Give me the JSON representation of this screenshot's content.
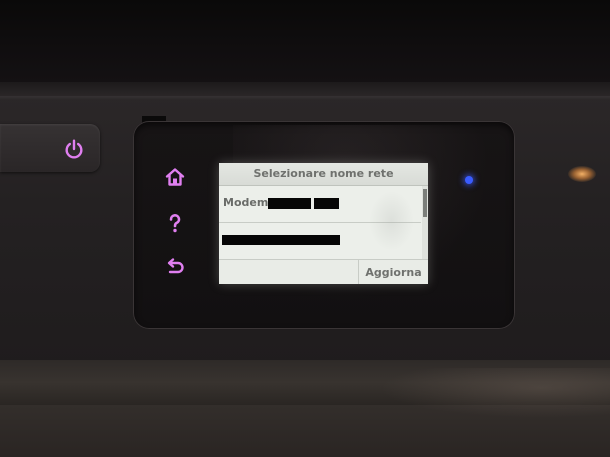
{
  "device": {
    "power_icon": "power-icon",
    "side_buttons": [
      {
        "icon": "home-icon",
        "color": "#e07ff0"
      },
      {
        "icon": "help-icon",
        "color": "#e07ff0"
      },
      {
        "icon": "back-arrow-icon",
        "color": "#e07ff0"
      }
    ],
    "status_led_color": "#3a5cff"
  },
  "screen": {
    "title": "Selezionare nome rete",
    "networks": [
      {
        "label": "Modem",
        "redacted": true
      },
      {
        "label": "",
        "redacted": true
      }
    ],
    "refresh_label": "Aggiorna"
  }
}
